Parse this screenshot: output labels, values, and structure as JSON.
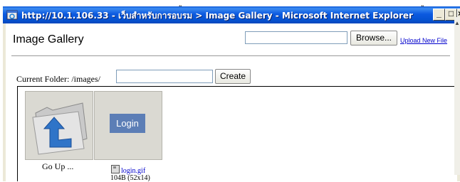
{
  "window": {
    "title": "http://10.1.106.33 - เว็บสำหรับการอบรม > Image Gallery - Microsoft Internet Explorer",
    "minimize_label": "_",
    "maximize_label": "□",
    "close_label": "×"
  },
  "header": {
    "title": "Image Gallery",
    "file_input_value": "",
    "browse_label": "Browse...",
    "upload_link": "Upload New File"
  },
  "folder": {
    "label": "Current Folder: /images/",
    "input_value": "",
    "create_label": "Create"
  },
  "gallery": {
    "items": [
      {
        "caption": "Go Up ..."
      },
      {
        "banner_text": "Login",
        "file_name": "login.gif",
        "file_info": "104B (52x14)"
      }
    ]
  },
  "colors": {
    "titlebar": "#0552d1",
    "link": "#0000cc",
    "login_banner": "#5c7eb6"
  }
}
